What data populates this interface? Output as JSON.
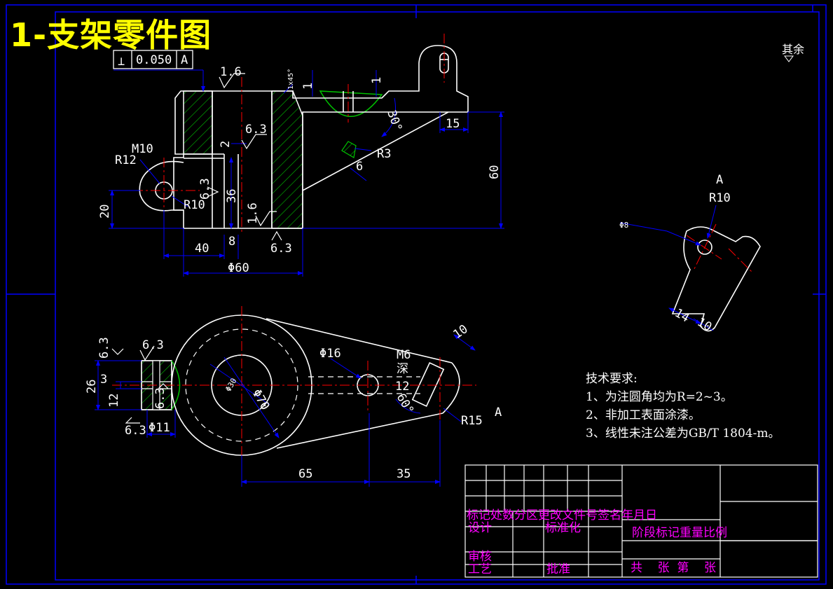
{
  "title": "1-支架零件图",
  "surface_rest": "其余",
  "tolerance_frame": {
    "symbol": "⊥",
    "value": "0.050",
    "datum": "A"
  },
  "roughness": {
    "r1": "1.6",
    "r2": "6.3",
    "r3": "6.3",
    "r4": "1.6",
    "r5": "6.3",
    "r6": "6.3",
    "r7": "6.3",
    "r8": "6.3",
    "r9": "6.3"
  },
  "front_view_dims": {
    "chamfer": "1x45°",
    "d1a": "1",
    "d1b": "1",
    "thread_m10": "M10",
    "r12": "R12",
    "r10": "R10",
    "d2": "2",
    "d36": "36",
    "d20": "20",
    "d40": "40",
    "d8": "8",
    "phi60": "Φ60",
    "angle30": "30°",
    "d15": "15",
    "r3": "R3",
    "d6": "6",
    "d60": "60"
  },
  "section_a": {
    "label": "A",
    "r10": "R10",
    "phi8": "Φ8",
    "d14": "14",
    "d10": "10"
  },
  "top_view_dims": {
    "d26": "26",
    "d3": "3",
    "d12": "12",
    "phi11": "Φ11",
    "phi30": "Φ30",
    "phi70": "Φ70",
    "phi16": "Φ16",
    "m6": "M6",
    "deep": "深",
    "d12b": "12",
    "angle60": "60°",
    "d10": "10",
    "r15": "R15",
    "view_a": "A",
    "d65": "65",
    "d35": "35"
  },
  "tech_requirements": {
    "heading": "技术要求:",
    "items": [
      "1、为注圆角均为R=2~3。",
      "2、非加工表面涂漆。",
      "3、线性未注公差为GB/T 1804-m。"
    ]
  },
  "title_block": {
    "row_mark": "标记处数分区更改文件号签名年月日",
    "design": "设计",
    "standardize": "标准化",
    "stage": "阶段标记重量比例",
    "review": "审核",
    "process": "工艺",
    "approve": "批准",
    "sheets": "共    张  第    张"
  },
  "colors": {
    "frame": "#0000ff",
    "outline": "#ffffff",
    "hatch": "#00c000",
    "center": "#ff0000",
    "dimension": "#0000ff",
    "title": "#ffff00",
    "titleblock_text": "#ff00ff"
  }
}
